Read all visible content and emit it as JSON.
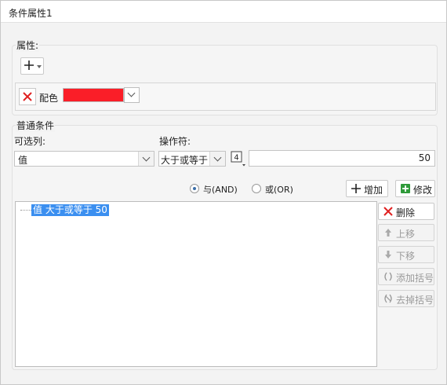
{
  "dialog": {
    "title": "条件属性1"
  },
  "properties": {
    "legend": "属性:",
    "item": {
      "label": "配色",
      "color": "#fa1e28"
    }
  },
  "conditions": {
    "legend": "普通条件",
    "column_label": "可选列:",
    "column_value": "值",
    "operator_label": "操作符:",
    "operator_value": "大于或等于",
    "value_input": "50",
    "format_icon_text": "4",
    "logic": {
      "and_label": "与(AND)",
      "or_label": "或(OR)",
      "selected": "and"
    },
    "add_button": "增加",
    "modify_button": "修改",
    "list": [
      {
        "text": "值 大于或等于 50",
        "selected": true
      }
    ],
    "side_buttons": {
      "delete": "删除",
      "move_up": "上移",
      "move_down": "下移",
      "add_bracket": "添加括号",
      "remove_bracket": "去掉括号"
    }
  },
  "colors": {
    "selection": "#3b8ff0",
    "accent_red": "#fa1e28",
    "add_green": "#2f9a3a"
  }
}
